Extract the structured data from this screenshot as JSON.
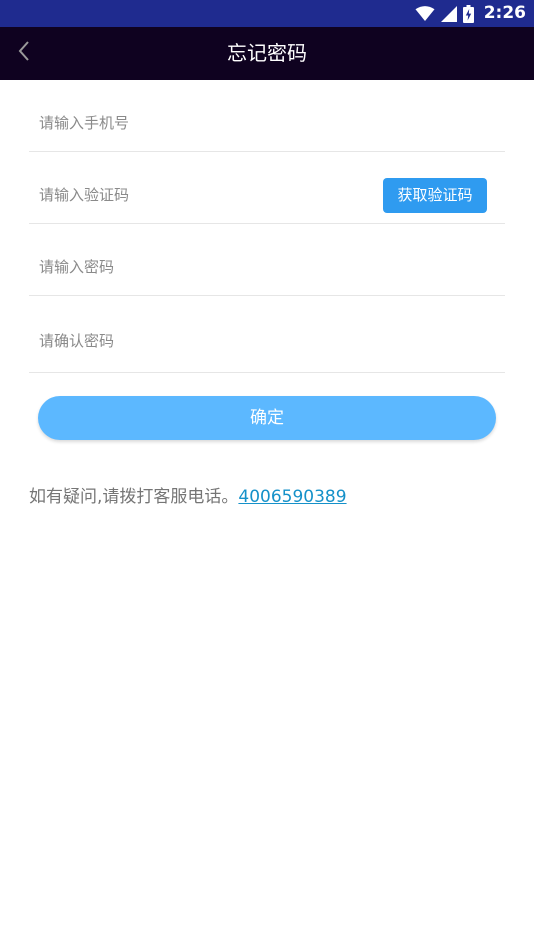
{
  "status_bar": {
    "time": "2:26",
    "color": "#1f2b8f"
  },
  "app_bar": {
    "title": "忘记密码",
    "back_icon": "chevron-left-icon",
    "color": "#0f0220"
  },
  "form": {
    "phone_placeholder": "请输入手机号",
    "code_placeholder": "请输入验证码",
    "get_code_label": "获取验证码",
    "password_placeholder": "请输入密码",
    "confirm_password_placeholder": "请确认密码",
    "submit_label": "确定",
    "accent_color": "#2f9bf0",
    "submit_color": "#5cb8ff"
  },
  "help": {
    "text": "如有疑问,请拨打客服电话。",
    "phone": "4006590389",
    "link_color": "#1591c9"
  }
}
